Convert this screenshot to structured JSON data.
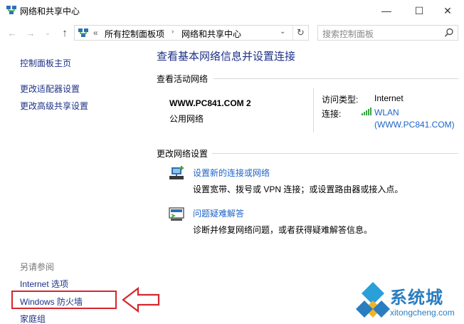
{
  "window": {
    "title": "网络和共享中心",
    "min_glyph": "—",
    "max_glyph": "☐",
    "close_glyph": "✕"
  },
  "nav": {
    "back_glyph": "←",
    "forward_glyph": "→",
    "recent_glyph": "⌄",
    "up_glyph": "↑"
  },
  "address": {
    "chevron": "«",
    "crumbs": [
      "所有控制面板项",
      "网络和共享中心"
    ],
    "separator": "›",
    "dropdown_glyph": "⌄",
    "refresh_glyph": "↻"
  },
  "search": {
    "placeholder": "搜索控制面板"
  },
  "sidebar": {
    "home": "控制面板主页",
    "adapter_settings": "更改适配器设置",
    "advanced_sharing": "更改高级共享设置",
    "see_also": "另请参阅",
    "internet_options": "Internet 选项",
    "firewall": "Windows 防火墙",
    "homegroup": "家庭组"
  },
  "main": {
    "title": "查看基本网络信息并设置连接",
    "active_networks_label": "查看活动网络",
    "network": {
      "name": "WWW.PC841.COM  2",
      "type": "公用网络",
      "access_type_label": "访问类型:",
      "access_type_value": "Internet",
      "connection_label": "连接:",
      "connection_value_line1": "WLAN",
      "connection_value_line2": "(WWW.PC841.COM)"
    },
    "change_settings_label": "更改网络设置",
    "tasks": [
      {
        "link": "设置新的连接或网络",
        "desc": "设置宽带、拨号或 VPN 连接；或设置路由器或接入点。",
        "icon": "new-connection-icon"
      },
      {
        "link": "问题疑难解答",
        "desc": "诊断并修复网络问题，或者获得疑难解答信息。",
        "icon": "troubleshoot-icon"
      }
    ]
  },
  "watermark": {
    "title": "系统城",
    "subtitle": "xitongcheng.com"
  },
  "colors": {
    "link_dark": "#1e3287",
    "link_blue": "#1e64c8",
    "annotation_red": "#d6262d",
    "watermark_blue": "#2a7dc0"
  }
}
